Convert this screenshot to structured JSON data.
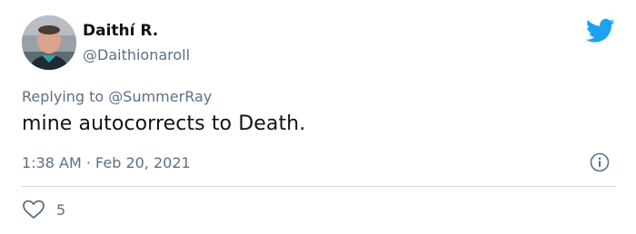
{
  "author": {
    "display_name": "Daithí R.",
    "handle": "@Daithionaroll"
  },
  "reply": {
    "prefix": "Replying to ",
    "mention": "@SummerRay"
  },
  "tweet": {
    "text": "mine autocorrects to Death.",
    "time": "1:38 AM",
    "separator": " · ",
    "date": "Feb 20, 2021"
  },
  "engagement": {
    "likes": "5"
  },
  "icons": {
    "logo": "twitter-bird-icon",
    "info": "info-icon",
    "like": "heart-outline-icon"
  },
  "colors": {
    "brand": "#1da1f2",
    "text_primary": "#0f1419",
    "text_secondary": "#5b7083",
    "divider": "#cfd9de"
  }
}
